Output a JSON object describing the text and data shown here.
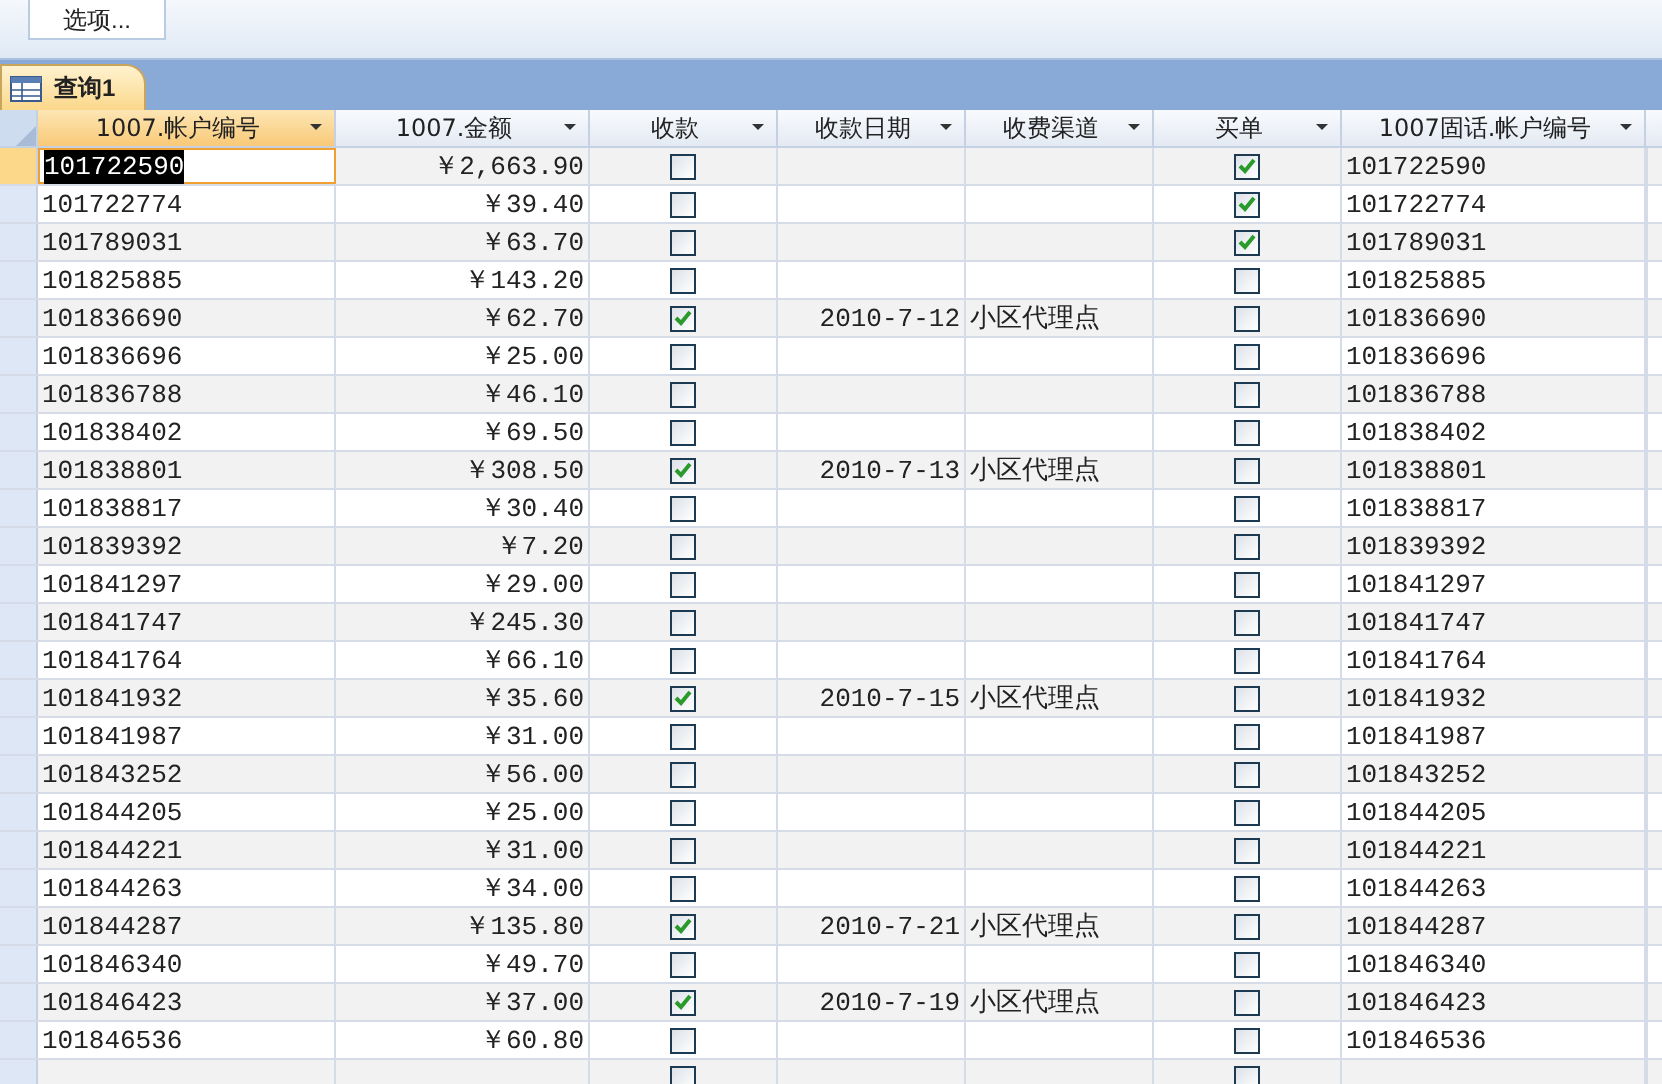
{
  "toolbar": {
    "options_button": "选项..."
  },
  "tab": {
    "label": "查询1",
    "selected": true
  },
  "table": {
    "columns": [
      {
        "label": "1007.帐户编号",
        "selected": true,
        "kind": "text"
      },
      {
        "label": "1007.金额",
        "selected": false,
        "kind": "money"
      },
      {
        "label": "收款",
        "selected": false,
        "kind": "check"
      },
      {
        "label": "收款日期",
        "selected": false,
        "kind": "date"
      },
      {
        "label": "收费渠道",
        "selected": false,
        "kind": "text"
      },
      {
        "label": "买单",
        "selected": false,
        "kind": "check"
      },
      {
        "label": "1007固话.帐户编号",
        "selected": false,
        "kind": "text"
      }
    ],
    "rows": [
      {
        "account": "101722590",
        "amount": "￥2,663.90",
        "paid": false,
        "date": "",
        "channel": "",
        "bought": true,
        "phone_account": "101722590",
        "selected": true
      },
      {
        "account": "101722774",
        "amount": "￥39.40",
        "paid": false,
        "date": "",
        "channel": "",
        "bought": true,
        "phone_account": "101722774",
        "selected": false
      },
      {
        "account": "101789031",
        "amount": "￥63.70",
        "paid": false,
        "date": "",
        "channel": "",
        "bought": true,
        "phone_account": "101789031",
        "selected": false
      },
      {
        "account": "101825885",
        "amount": "￥143.20",
        "paid": false,
        "date": "",
        "channel": "",
        "bought": false,
        "phone_account": "101825885",
        "selected": false
      },
      {
        "account": "101836690",
        "amount": "￥62.70",
        "paid": true,
        "date": "2010-7-12",
        "channel": "小区代理点",
        "bought": false,
        "phone_account": "101836690",
        "selected": false
      },
      {
        "account": "101836696",
        "amount": "￥25.00",
        "paid": false,
        "date": "",
        "channel": "",
        "bought": false,
        "phone_account": "101836696",
        "selected": false
      },
      {
        "account": "101836788",
        "amount": "￥46.10",
        "paid": false,
        "date": "",
        "channel": "",
        "bought": false,
        "phone_account": "101836788",
        "selected": false
      },
      {
        "account": "101838402",
        "amount": "￥69.50",
        "paid": false,
        "date": "",
        "channel": "",
        "bought": false,
        "phone_account": "101838402",
        "selected": false
      },
      {
        "account": "101838801",
        "amount": "￥308.50",
        "paid": true,
        "date": "2010-7-13",
        "channel": "小区代理点",
        "bought": false,
        "phone_account": "101838801",
        "selected": false
      },
      {
        "account": "101838817",
        "amount": "￥30.40",
        "paid": false,
        "date": "",
        "channel": "",
        "bought": false,
        "phone_account": "101838817",
        "selected": false
      },
      {
        "account": "101839392",
        "amount": "￥7.20",
        "paid": false,
        "date": "",
        "channel": "",
        "bought": false,
        "phone_account": "101839392",
        "selected": false
      },
      {
        "account": "101841297",
        "amount": "￥29.00",
        "paid": false,
        "date": "",
        "channel": "",
        "bought": false,
        "phone_account": "101841297",
        "selected": false
      },
      {
        "account": "101841747",
        "amount": "￥245.30",
        "paid": false,
        "date": "",
        "channel": "",
        "bought": false,
        "phone_account": "101841747",
        "selected": false
      },
      {
        "account": "101841764",
        "amount": "￥66.10",
        "paid": false,
        "date": "",
        "channel": "",
        "bought": false,
        "phone_account": "101841764",
        "selected": false
      },
      {
        "account": "101841932",
        "amount": "￥35.60",
        "paid": true,
        "date": "2010-7-15",
        "channel": "小区代理点",
        "bought": false,
        "phone_account": "101841932",
        "selected": false
      },
      {
        "account": "101841987",
        "amount": "￥31.00",
        "paid": false,
        "date": "",
        "channel": "",
        "bought": false,
        "phone_account": "101841987",
        "selected": false
      },
      {
        "account": "101843252",
        "amount": "￥56.00",
        "paid": false,
        "date": "",
        "channel": "",
        "bought": false,
        "phone_account": "101843252",
        "selected": false
      },
      {
        "account": "101844205",
        "amount": "￥25.00",
        "paid": false,
        "date": "",
        "channel": "",
        "bought": false,
        "phone_account": "101844205",
        "selected": false
      },
      {
        "account": "101844221",
        "amount": "￥31.00",
        "paid": false,
        "date": "",
        "channel": "",
        "bought": false,
        "phone_account": "101844221",
        "selected": false
      },
      {
        "account": "101844263",
        "amount": "￥34.00",
        "paid": false,
        "date": "",
        "channel": "",
        "bought": false,
        "phone_account": "101844263",
        "selected": false
      },
      {
        "account": "101844287",
        "amount": "￥135.80",
        "paid": true,
        "date": "2010-7-21",
        "channel": "小区代理点",
        "bought": false,
        "phone_account": "101844287",
        "selected": false
      },
      {
        "account": "101846340",
        "amount": "￥49.70",
        "paid": false,
        "date": "",
        "channel": "",
        "bought": false,
        "phone_account": "101846340",
        "selected": false
      },
      {
        "account": "101846423",
        "amount": "￥37.00",
        "paid": true,
        "date": "2010-7-19",
        "channel": "小区代理点",
        "bought": false,
        "phone_account": "101846423",
        "selected": false
      },
      {
        "account": "101846536",
        "amount": "￥60.80",
        "paid": false,
        "date": "",
        "channel": "",
        "bought": false,
        "phone_account": "101846536",
        "selected": false
      },
      {
        "paid": false,
        "bought": false,
        "selected": false
      }
    ]
  }
}
